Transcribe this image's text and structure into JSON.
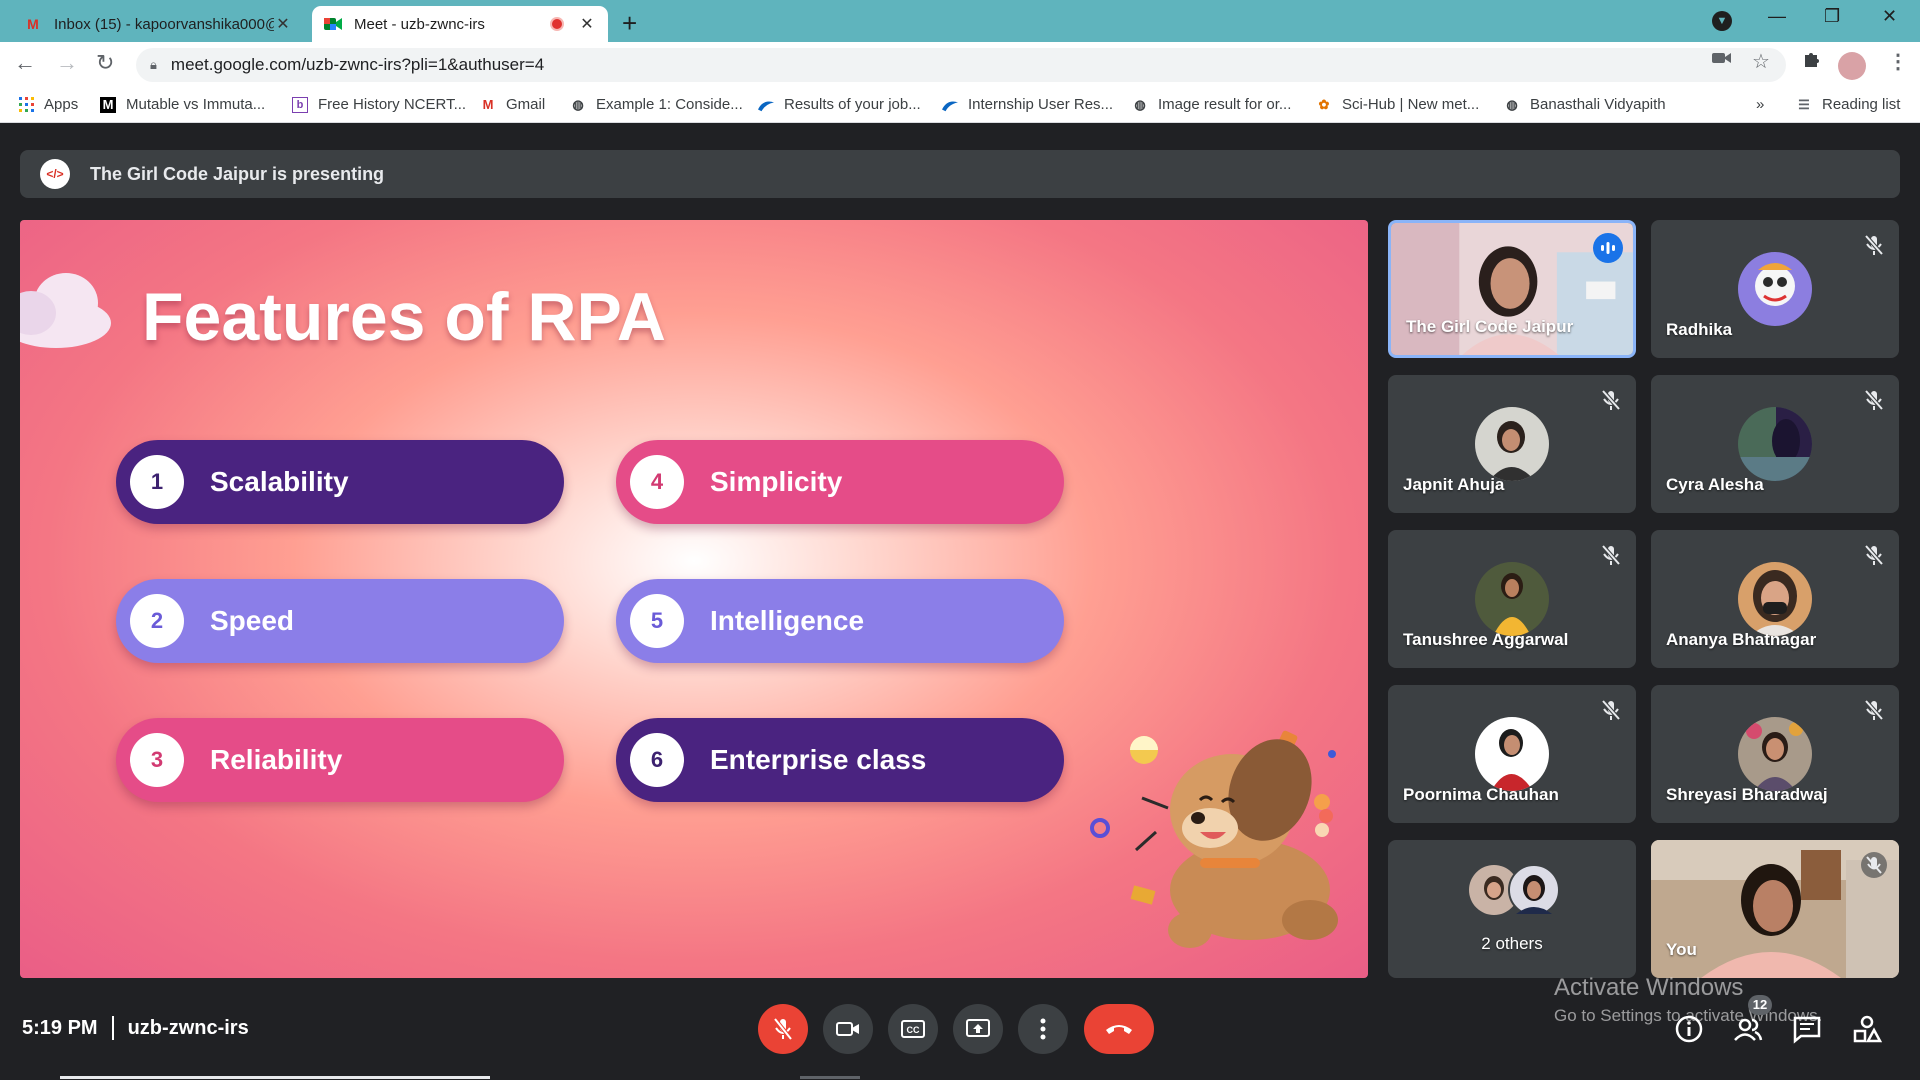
{
  "browser": {
    "tabs": [
      {
        "title": "Inbox (15) - kapoorvanshika000@",
        "favicon": "gmail-icon"
      },
      {
        "title": "Meet - uzb-zwnc-irs",
        "favicon": "meet-icon",
        "recording": true
      }
    ],
    "url": "meet.google.com/uzb-zwnc-irs?pli=1&authuser=4",
    "bookmarks": [
      {
        "label": "Apps",
        "icon": "apps-grid-icon"
      },
      {
        "label": "Mutable vs Immuta...",
        "icon": "medium-icon"
      },
      {
        "label": "Free History NCERT...",
        "icon": "bookmark-b-icon"
      },
      {
        "label": "Gmail",
        "icon": "gmail-icon"
      },
      {
        "label": "Example 1: Conside...",
        "icon": "globe-icon"
      },
      {
        "label": "Results of your job...",
        "icon": "wave-icon"
      },
      {
        "label": "Internship User Res...",
        "icon": "wave-icon"
      },
      {
        "label": "Image result for or...",
        "icon": "globe-icon"
      },
      {
        "label": "Sci-Hub | New met...",
        "icon": "scihub-icon"
      },
      {
        "label": "Banasthali Vidyapith",
        "icon": "globe-icon"
      }
    ],
    "overflow": "»",
    "reading_list": "Reading list"
  },
  "meet": {
    "presenting_banner": "The Girl Code Jaipur is presenting",
    "slide": {
      "title": "Features of RPA",
      "features": [
        {
          "num": "1",
          "label": "Scalability",
          "style": "dark"
        },
        {
          "num": "2",
          "label": "Speed",
          "style": "lav"
        },
        {
          "num": "3",
          "label": "Reliability",
          "style": "pink"
        },
        {
          "num": "4",
          "label": "Simplicity",
          "style": "pink"
        },
        {
          "num": "5",
          "label": "Intelligence",
          "style": "lav"
        },
        {
          "num": "6",
          "label": "Enterprise class",
          "style": "dark"
        }
      ]
    },
    "participants": [
      {
        "name": "The Girl Code Jaipur",
        "type": "video",
        "speaking": true
      },
      {
        "name": "Radhika",
        "type": "avatar",
        "muted": true
      },
      {
        "name": "Japnit Ahuja",
        "type": "avatar",
        "muted": true
      },
      {
        "name": "Cyra Alesha",
        "type": "avatar",
        "muted": true
      },
      {
        "name": "Tanushree Aggarwal",
        "type": "avatar",
        "muted": true
      },
      {
        "name": "Ananya Bhatnagar",
        "type": "avatar",
        "muted": true
      },
      {
        "name": "Poornima Chauhan",
        "type": "avatar",
        "muted": true
      },
      {
        "name": "Shreyasi Bharadwaj",
        "type": "avatar",
        "muted": true
      },
      {
        "name": "2 others",
        "type": "group"
      },
      {
        "name": "You",
        "type": "video",
        "muted": true
      }
    ],
    "time": "5:19 PM",
    "meeting_code": "uzb-zwnc-irs",
    "people_count": "12",
    "watermark": {
      "line1": "Activate Windows",
      "line2": "Go to Settings to activate Windows."
    }
  }
}
